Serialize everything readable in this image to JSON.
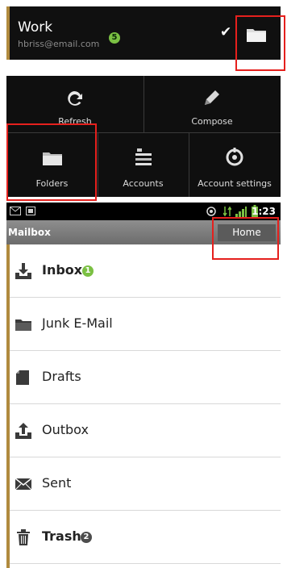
{
  "account": {
    "name": "Work",
    "email": "hbriss@email.com",
    "unread_count": "5"
  },
  "menu": {
    "items": [
      {
        "label": "Refresh",
        "icon": "refresh-icon"
      },
      {
        "label": "Compose",
        "icon": "compose-icon"
      },
      {
        "label": "Folders",
        "icon": "folder-icon"
      },
      {
        "label": "Accounts",
        "icon": "accounts-icon"
      },
      {
        "label": "Account settings",
        "icon": "settings-icon"
      }
    ]
  },
  "status_bar": {
    "time": "1:23"
  },
  "mailbox": {
    "title": "Mailbox",
    "home_label": "Home",
    "folders": [
      {
        "label": "Inbox",
        "icon": "inbox-icon",
        "badge": "1",
        "bold": true
      },
      {
        "label": "Junk E-Mail",
        "icon": "folder-icon",
        "badge": null,
        "bold": false
      },
      {
        "label": "Drafts",
        "icon": "drafts-icon",
        "badge": null,
        "bold": false
      },
      {
        "label": "Outbox",
        "icon": "outbox-icon",
        "badge": null,
        "bold": false
      },
      {
        "label": "Sent",
        "icon": "sent-icon",
        "badge": null,
        "bold": false
      },
      {
        "label": "Trash",
        "icon": "trash-icon",
        "badge": "2",
        "bold": true
      }
    ]
  },
  "colors": {
    "highlight": "#e5201d",
    "badge_green": "#7bc043",
    "badge_gray": "#4d4d4d",
    "accent_bar": "#b08a3e"
  }
}
